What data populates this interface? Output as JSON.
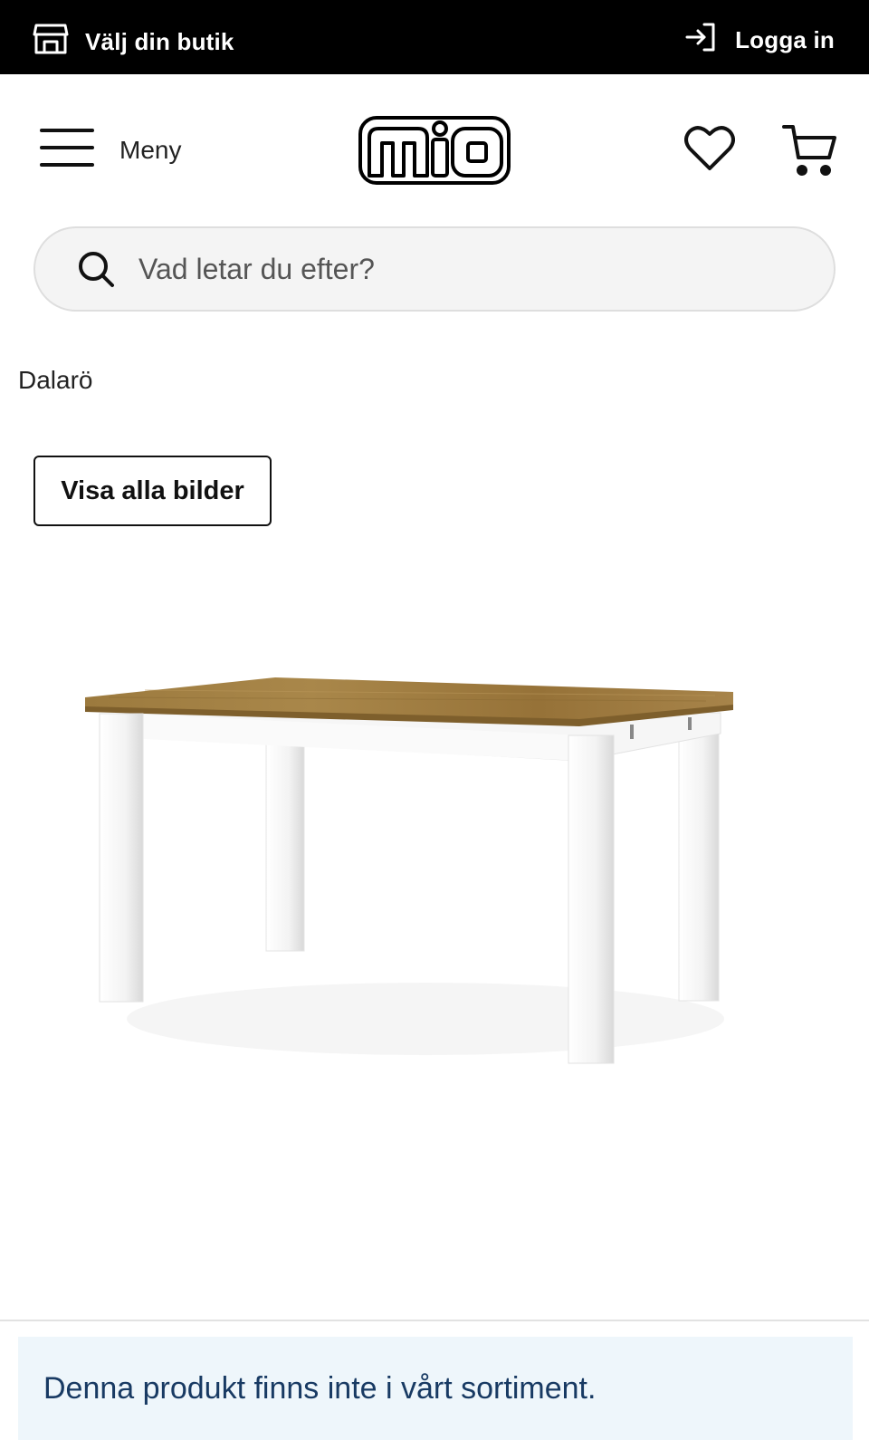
{
  "topbar": {
    "store_label": "Välj din butik",
    "login_label": "Logga in"
  },
  "header": {
    "menu_label": "Meny",
    "logo_text": "mio"
  },
  "search": {
    "placeholder": "Vad letar du efter?"
  },
  "breadcrumb": "Dalarö",
  "gallery": {
    "show_all_label": "Visa alla bilder"
  },
  "notice": {
    "text": "Denna produkt finns inte i vårt sortiment."
  },
  "colors": {
    "topbar_bg": "#000000",
    "notice_bg": "#eef6fb",
    "notice_text": "#183a63",
    "search_bg": "#f4f4f4"
  },
  "icons": [
    "store-icon",
    "login-icon",
    "hamburger-icon",
    "heart-icon",
    "cart-icon",
    "search-icon"
  ]
}
